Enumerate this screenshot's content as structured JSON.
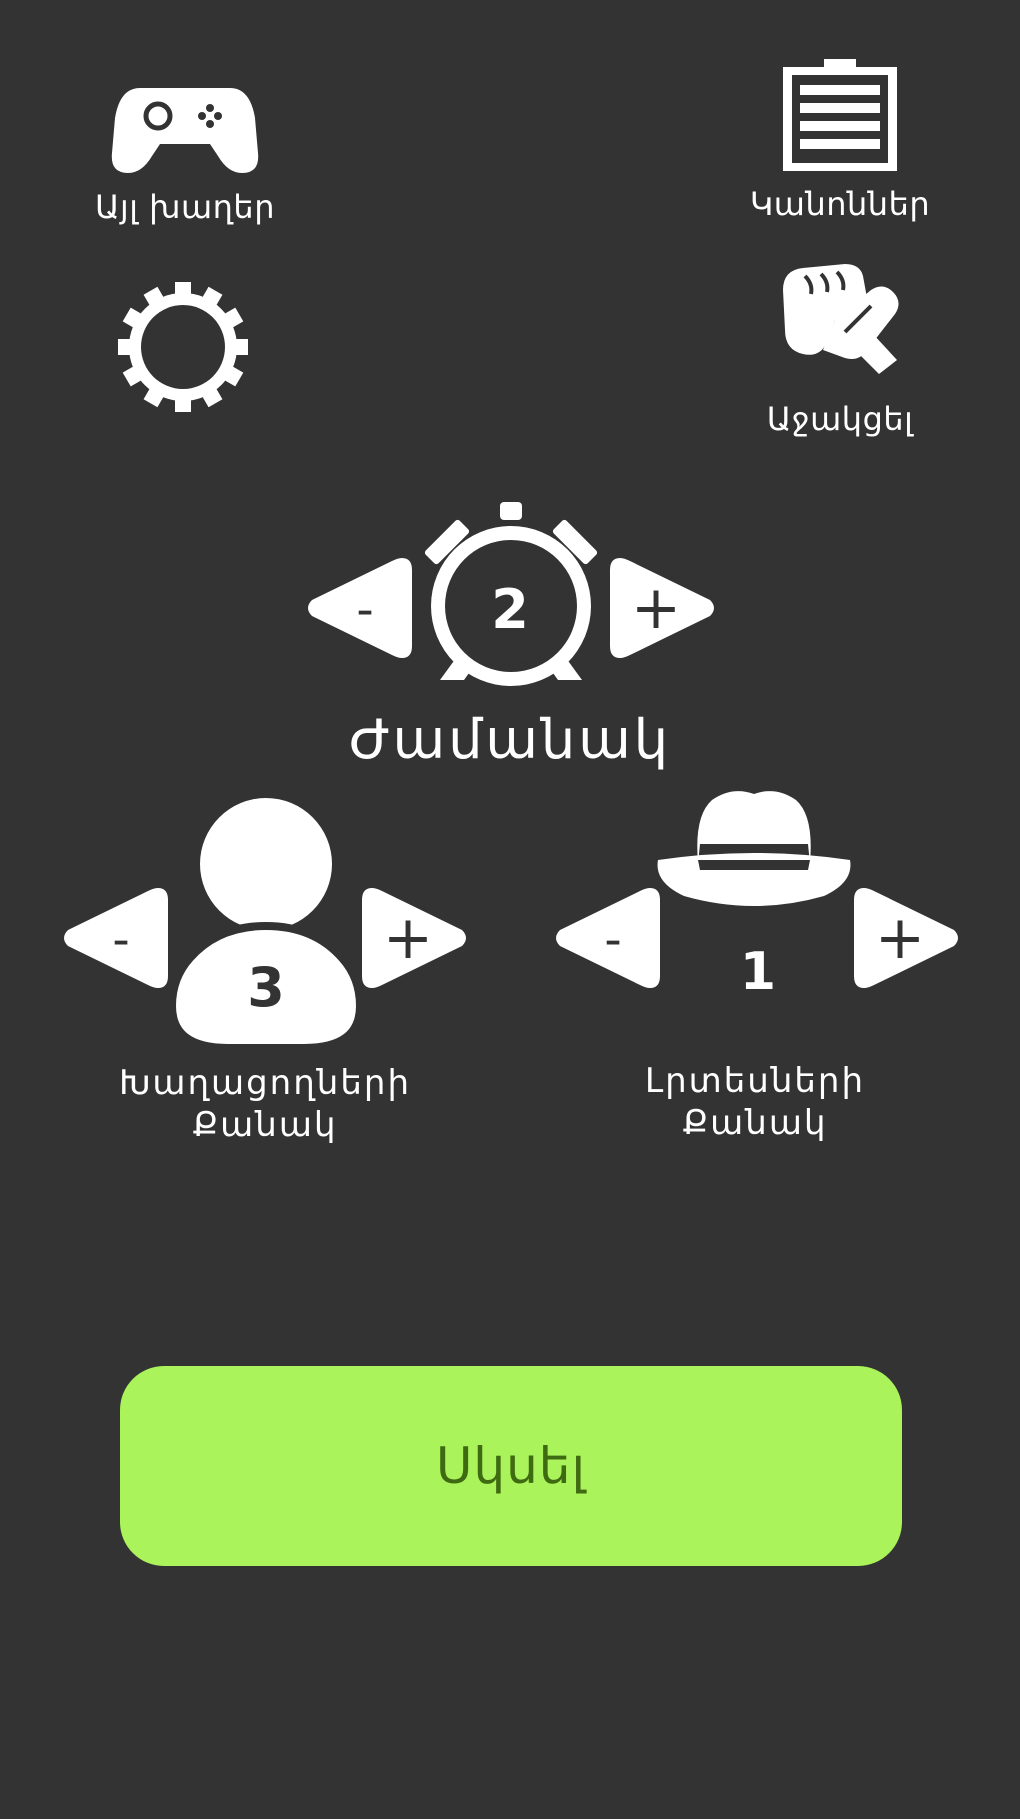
{
  "top_menu": {
    "other_games_label": "Այլ խաղեր",
    "rules_label": "Կանոններ",
    "support_label": "Աջակցել"
  },
  "timer": {
    "value": "2",
    "label": "Ժամանակ"
  },
  "players": {
    "value": "3",
    "label_line1": "Խաղացողների",
    "label_line2": "Քանակ"
  },
  "spies": {
    "value": "1",
    "label_line1": "Լրտեսների",
    "label_line2": "Քանակ"
  },
  "controls": {
    "minus": "-",
    "plus": "+"
  },
  "start_button": {
    "label": "Սկսել"
  },
  "colors": {
    "background": "#333333",
    "accent": "#aaf35a",
    "foreground": "#ffffff"
  },
  "icons": [
    "gamepad-icon",
    "rules-list-icon",
    "gear-icon",
    "handshake-icon",
    "alarm-clock-icon",
    "player-icon",
    "spy-hat-icon"
  ]
}
